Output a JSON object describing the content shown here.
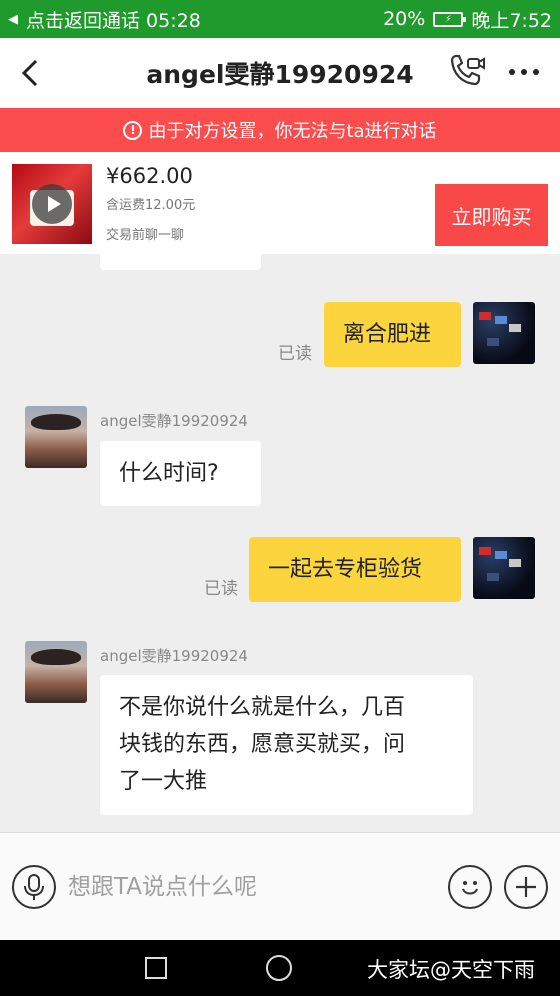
{
  "status_bar": {
    "call_text": "点击返回通话 05:28",
    "battery_text": "20%",
    "time": "晚上7:52"
  },
  "header": {
    "title": "angel雯静19920924",
    "back_icon": "back-arrow-icon",
    "call_icon": "phone-video-icon",
    "more_icon": "more-dots-icon"
  },
  "banner": {
    "text": "由于对方设置，你无法与ta进行对话",
    "icon": "info-icon",
    "color": "#fb4d4d"
  },
  "product": {
    "price": "¥662.00",
    "shipping": "含运费12.00元",
    "chat_first": "交易前聊一聊",
    "buy_label": "立即购买",
    "play_icon": "play-icon"
  },
  "messages": [
    {
      "side": "out",
      "read": "已读",
      "text": "离合肥进"
    },
    {
      "side": "in",
      "nickname": "angel雯静19920924",
      "text": "什么时间?"
    },
    {
      "side": "out",
      "read": "已读",
      "text": "一起去专柜验货"
    },
    {
      "side": "in",
      "nickname": "angel雯静19920924",
      "lines": [
        "不是你说什么就是什么，几百",
        "块钱的东西，愿意买就买，问",
        "了一大推"
      ]
    }
  ],
  "input_bar": {
    "placeholder": "想跟TA说点什么呢",
    "mic_icon": "microphone-icon",
    "emoji_icon": "emoji-smile-icon",
    "plus_icon": "plus-icon"
  },
  "nav_bar": {
    "watermark": "大家坛@天空下雨"
  },
  "colors": {
    "status_bar": "#1f9a2c",
    "outgoing_bubble": "#fcd53e",
    "buy_button": "#f94848"
  }
}
